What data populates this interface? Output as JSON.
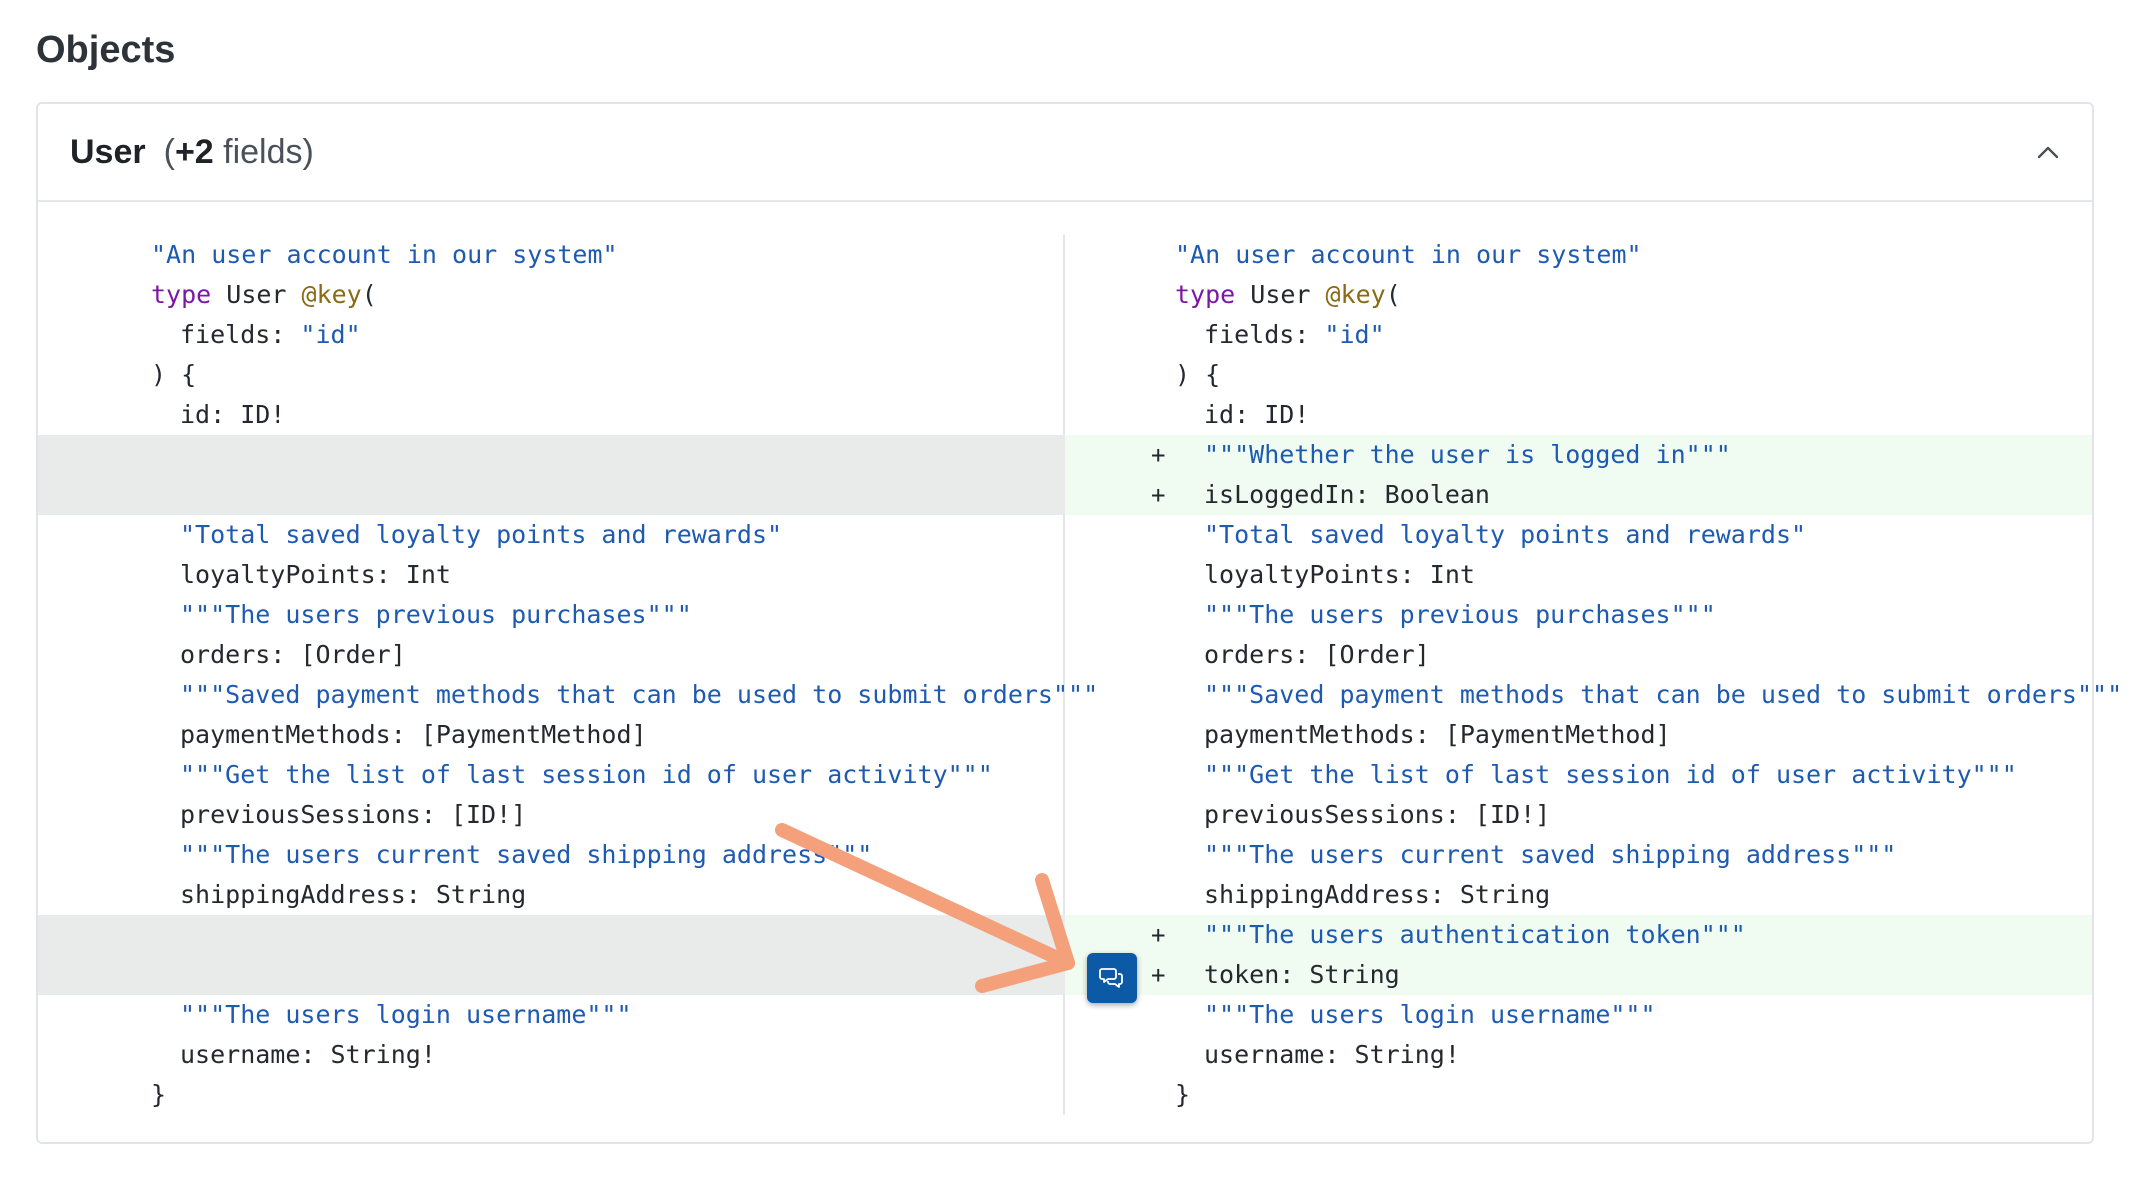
{
  "section": {
    "title": "Objects"
  },
  "card": {
    "type_name": "User",
    "count_open": "(",
    "count_value": "+2",
    "count_suffix": " fields)"
  },
  "colors": {
    "added_bg": "#f0fcf1",
    "empty_bg": "#e9eaea",
    "string": "#1d5ab1",
    "keyword": "#7c16a8",
    "directive": "#8a6a16",
    "comment_button": "#0c5aa6",
    "arrow": "#f4a07b"
  },
  "icons": {
    "collapse": "chevron-up-icon",
    "comment": "comment-icon"
  },
  "diff": {
    "left": [
      {
        "type": "ctx",
        "indent": 0,
        "tokens": [
          {
            "t": "\"An user account in our system\"",
            "c": "str"
          }
        ]
      },
      {
        "type": "ctx",
        "indent": 0,
        "tokens": [
          {
            "t": "type",
            "c": "kw"
          },
          {
            "t": " User ",
            "c": "id"
          },
          {
            "t": "@key",
            "c": "dir"
          },
          {
            "t": "(",
            "c": "id"
          }
        ]
      },
      {
        "type": "ctx",
        "indent": 1,
        "tokens": [
          {
            "t": "fields: ",
            "c": "id"
          },
          {
            "t": "\"id\"",
            "c": "str"
          }
        ]
      },
      {
        "type": "ctx",
        "indent": 0,
        "tokens": [
          {
            "t": ") {",
            "c": "id"
          }
        ]
      },
      {
        "type": "ctx",
        "indent": 1,
        "tokens": [
          {
            "t": "id: ID!",
            "c": "id"
          }
        ]
      },
      {
        "type": "empty"
      },
      {
        "type": "empty"
      },
      {
        "type": "ctx",
        "indent": 1,
        "tokens": [
          {
            "t": "\"Total saved loyalty points and rewards\"",
            "c": "str"
          }
        ]
      },
      {
        "type": "ctx",
        "indent": 1,
        "tokens": [
          {
            "t": "loyaltyPoints: Int",
            "c": "id"
          }
        ]
      },
      {
        "type": "ctx",
        "indent": 1,
        "tokens": [
          {
            "t": "\"\"\"The users previous purchases\"\"\"",
            "c": "str"
          }
        ]
      },
      {
        "type": "ctx",
        "indent": 1,
        "tokens": [
          {
            "t": "orders: [Order]",
            "c": "id"
          }
        ]
      },
      {
        "type": "ctx",
        "indent": 1,
        "tokens": [
          {
            "t": "\"\"\"Saved payment methods that can be used to submit orders\"\"\"",
            "c": "str"
          }
        ]
      },
      {
        "type": "ctx",
        "indent": 1,
        "tokens": [
          {
            "t": "paymentMethods: [PaymentMethod]",
            "c": "id"
          }
        ]
      },
      {
        "type": "ctx",
        "indent": 1,
        "tokens": [
          {
            "t": "\"\"\"Get the list of last session id of user activity\"\"\"",
            "c": "str"
          }
        ]
      },
      {
        "type": "ctx",
        "indent": 1,
        "tokens": [
          {
            "t": "previousSessions: [ID!]",
            "c": "id"
          }
        ]
      },
      {
        "type": "ctx",
        "indent": 1,
        "tokens": [
          {
            "t": "\"\"\"The users current saved shipping address\"\"\"",
            "c": "str"
          }
        ]
      },
      {
        "type": "ctx",
        "indent": 1,
        "tokens": [
          {
            "t": "shippingAddress: String",
            "c": "id"
          }
        ]
      },
      {
        "type": "empty"
      },
      {
        "type": "empty"
      },
      {
        "type": "ctx",
        "indent": 1,
        "tokens": [
          {
            "t": "\"\"\"The users login username\"\"\"",
            "c": "str"
          }
        ]
      },
      {
        "type": "ctx",
        "indent": 1,
        "tokens": [
          {
            "t": "username: String!",
            "c": "id"
          }
        ]
      },
      {
        "type": "ctx",
        "indent": 0,
        "tokens": [
          {
            "t": "}",
            "c": "id"
          }
        ]
      }
    ],
    "right": [
      {
        "type": "ctx",
        "indent": 0,
        "tokens": [
          {
            "t": "\"An user account in our system\"",
            "c": "str"
          }
        ]
      },
      {
        "type": "ctx",
        "indent": 0,
        "tokens": [
          {
            "t": "type",
            "c": "kw"
          },
          {
            "t": " User ",
            "c": "id"
          },
          {
            "t": "@key",
            "c": "dir"
          },
          {
            "t": "(",
            "c": "id"
          }
        ]
      },
      {
        "type": "ctx",
        "indent": 1,
        "tokens": [
          {
            "t": "fields: ",
            "c": "id"
          },
          {
            "t": "\"id\"",
            "c": "str"
          }
        ]
      },
      {
        "type": "ctx",
        "indent": 0,
        "tokens": [
          {
            "t": ") {",
            "c": "id"
          }
        ]
      },
      {
        "type": "ctx",
        "indent": 1,
        "tokens": [
          {
            "t": "id: ID!",
            "c": "id"
          }
        ]
      },
      {
        "type": "add",
        "marker": "+",
        "indent": 1,
        "tokens": [
          {
            "t": "\"\"\"Whether the user is logged in\"\"\"",
            "c": "str"
          }
        ]
      },
      {
        "type": "add",
        "marker": "+",
        "indent": 1,
        "tokens": [
          {
            "t": "isLoggedIn: Boolean",
            "c": "id"
          }
        ]
      },
      {
        "type": "ctx",
        "indent": 1,
        "tokens": [
          {
            "t": "\"Total saved loyalty points and rewards\"",
            "c": "str"
          }
        ]
      },
      {
        "type": "ctx",
        "indent": 1,
        "tokens": [
          {
            "t": "loyaltyPoints: Int",
            "c": "id"
          }
        ]
      },
      {
        "type": "ctx",
        "indent": 1,
        "tokens": [
          {
            "t": "\"\"\"The users previous purchases\"\"\"",
            "c": "str"
          }
        ]
      },
      {
        "type": "ctx",
        "indent": 1,
        "tokens": [
          {
            "t": "orders: [Order]",
            "c": "id"
          }
        ]
      },
      {
        "type": "ctx",
        "indent": 1,
        "tokens": [
          {
            "t": "\"\"\"Saved payment methods that can be used to submit orders\"\"\"",
            "c": "str"
          }
        ]
      },
      {
        "type": "ctx",
        "indent": 1,
        "tokens": [
          {
            "t": "paymentMethods: [PaymentMethod]",
            "c": "id"
          }
        ]
      },
      {
        "type": "ctx",
        "indent": 1,
        "tokens": [
          {
            "t": "\"\"\"Get the list of last session id of user activity\"\"\"",
            "c": "str"
          }
        ]
      },
      {
        "type": "ctx",
        "indent": 1,
        "tokens": [
          {
            "t": "previousSessions: [ID!]",
            "c": "id"
          }
        ]
      },
      {
        "type": "ctx",
        "indent": 1,
        "tokens": [
          {
            "t": "\"\"\"The users current saved shipping address\"\"\"",
            "c": "str"
          }
        ]
      },
      {
        "type": "ctx",
        "indent": 1,
        "tokens": [
          {
            "t": "shippingAddress: String",
            "c": "id"
          }
        ]
      },
      {
        "type": "add",
        "marker": "+",
        "indent": 1,
        "tokens": [
          {
            "t": "\"\"\"The users authentication token\"\"\"",
            "c": "str"
          }
        ]
      },
      {
        "type": "add",
        "marker": "+",
        "indent": 1,
        "tokens": [
          {
            "t": "token: String",
            "c": "id"
          }
        ]
      },
      {
        "type": "ctx",
        "indent": 1,
        "tokens": [
          {
            "t": "\"\"\"The users login username\"\"\"",
            "c": "str"
          }
        ]
      },
      {
        "type": "ctx",
        "indent": 1,
        "tokens": [
          {
            "t": "username: String!",
            "c": "id"
          }
        ]
      },
      {
        "type": "ctx",
        "indent": 0,
        "tokens": [
          {
            "t": "}",
            "c": "id"
          }
        ]
      }
    ]
  }
}
